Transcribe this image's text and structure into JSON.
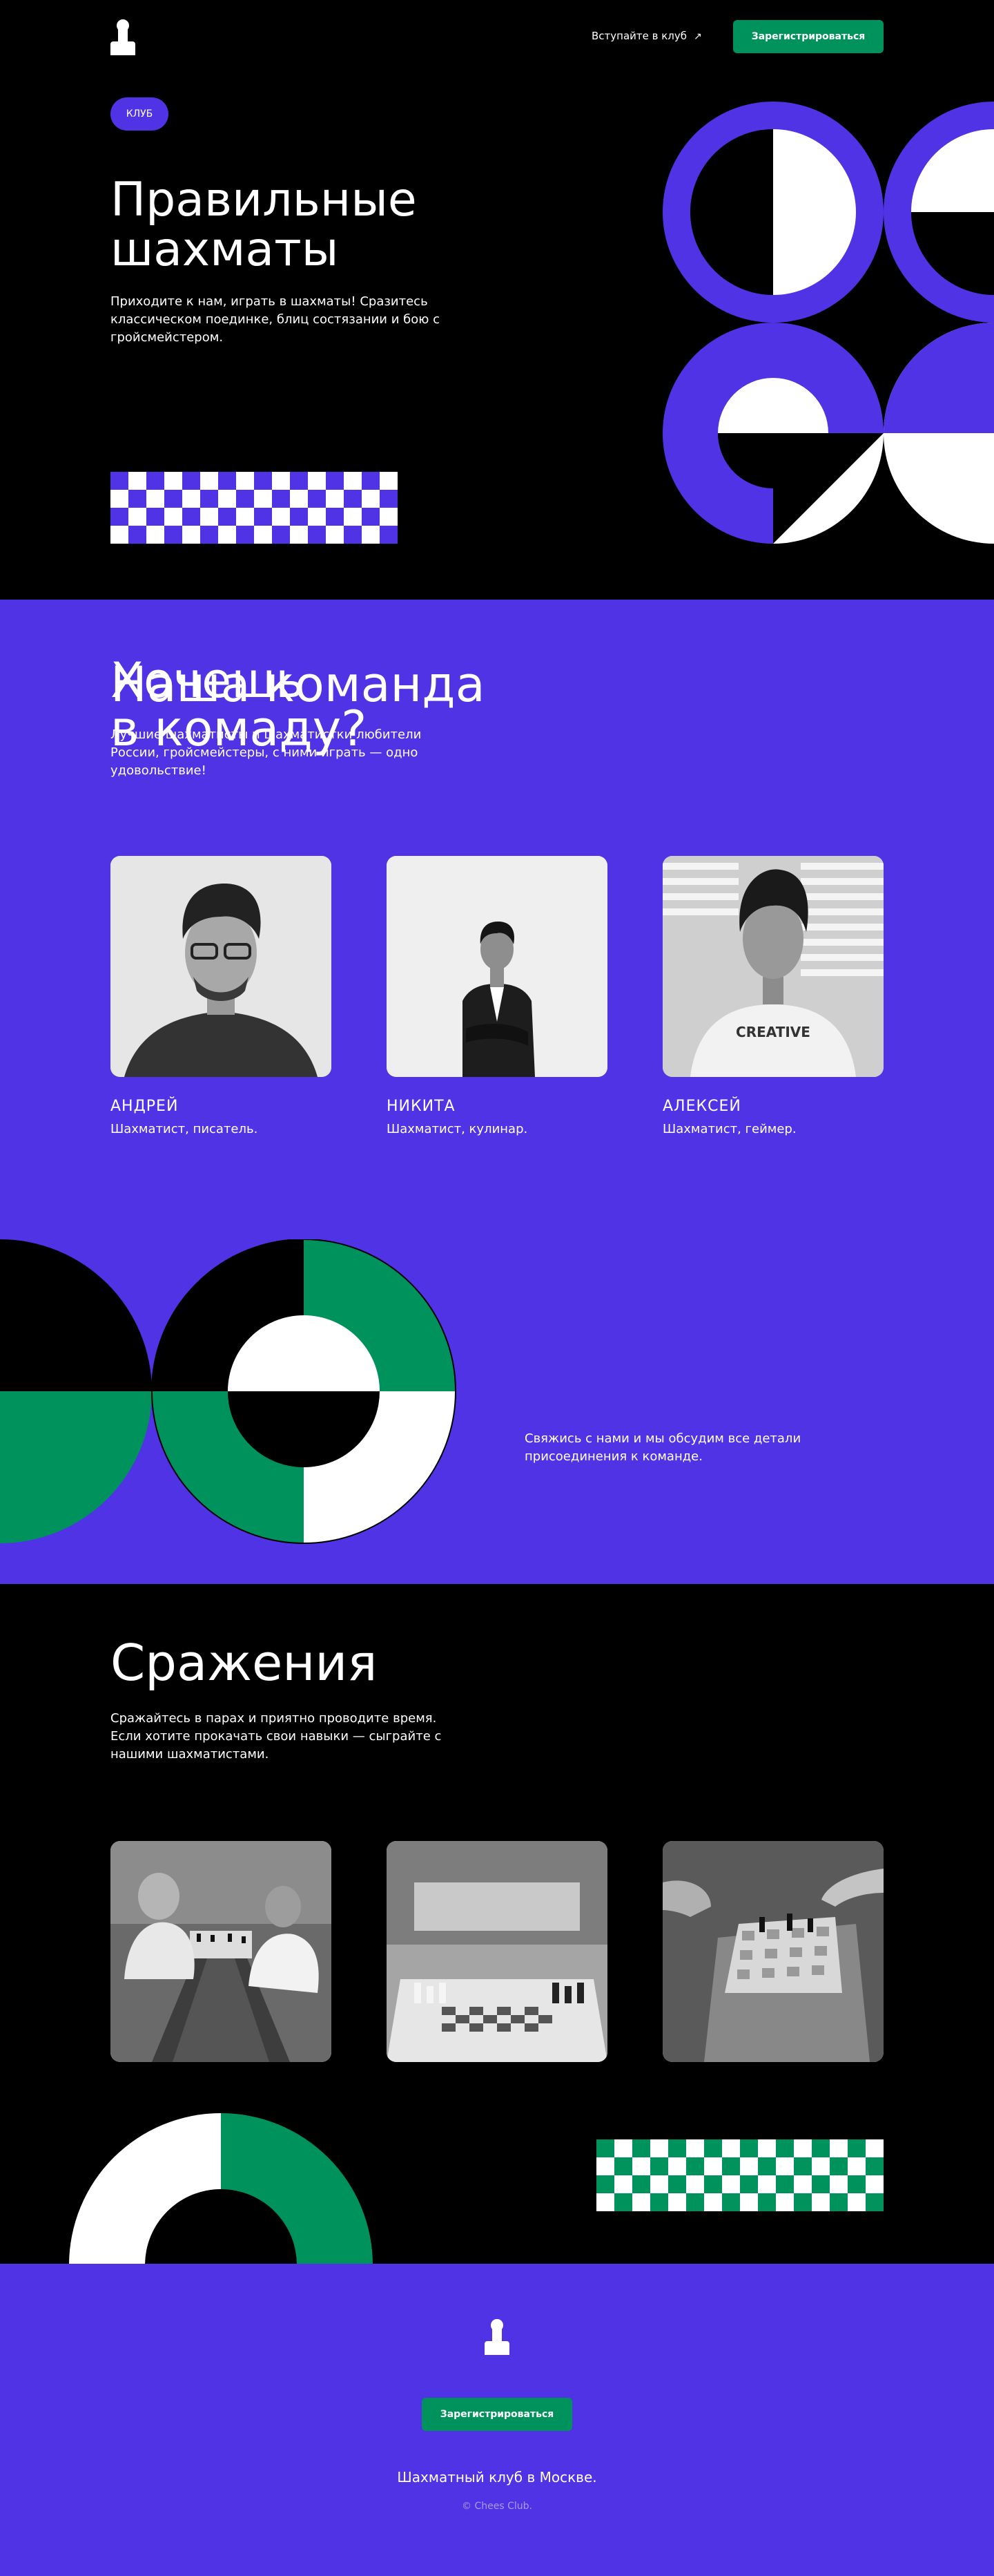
{
  "colors": {
    "brand": "#5133e6",
    "accent": "#00925d",
    "dark": "#000000",
    "light": "#ffffff"
  },
  "nav": {
    "logo_icon": "chess-pawn-icon",
    "link": "Вступайте в клуб",
    "link_icon": "arrow-up-right-icon",
    "cta": "Зарегистрироваться"
  },
  "hero": {
    "badge": "КЛУБ",
    "title_line1": "Правильные",
    "title_line2": "шахматы",
    "lead": "Приходите к нам, играть в шахматы! Сразитесь классическом поединке, блиц состязании и бою с гройсмейстером."
  },
  "team": {
    "title": "Наша команда",
    "lead": "Лучшие шахматисты и шахматистки любители России, гройсмейстеры, с ними играть — одно удовольствие!",
    "members": [
      {
        "name": "АНДРЕЙ",
        "role": "Шахматист, писатель."
      },
      {
        "name": "НИКИТА",
        "role": "Шахматист, кулинар."
      },
      {
        "name": "АЛЕКСЕЙ",
        "role": "Шахматист, геймер.",
        "shirt": "CREATIVE"
      }
    ]
  },
  "join": {
    "title_line1": "Хочешь",
    "title_line2": "в комаду?",
    "lead": "Свяжись с нами и мы обсудим все детали присоединения к команде."
  },
  "fights": {
    "title": "Сражения",
    "lead": "Сражайтесь в парах и приятно проводите время. Если хотите прокачать свои навыки — сыграйте с нашими шахматистами."
  },
  "footer": {
    "logo_icon": "chess-pawn-icon",
    "cta": "Зарегистрироваться",
    "tagline": "Шахматный клуб в Москве.",
    "copyright": "© Chees Club."
  }
}
